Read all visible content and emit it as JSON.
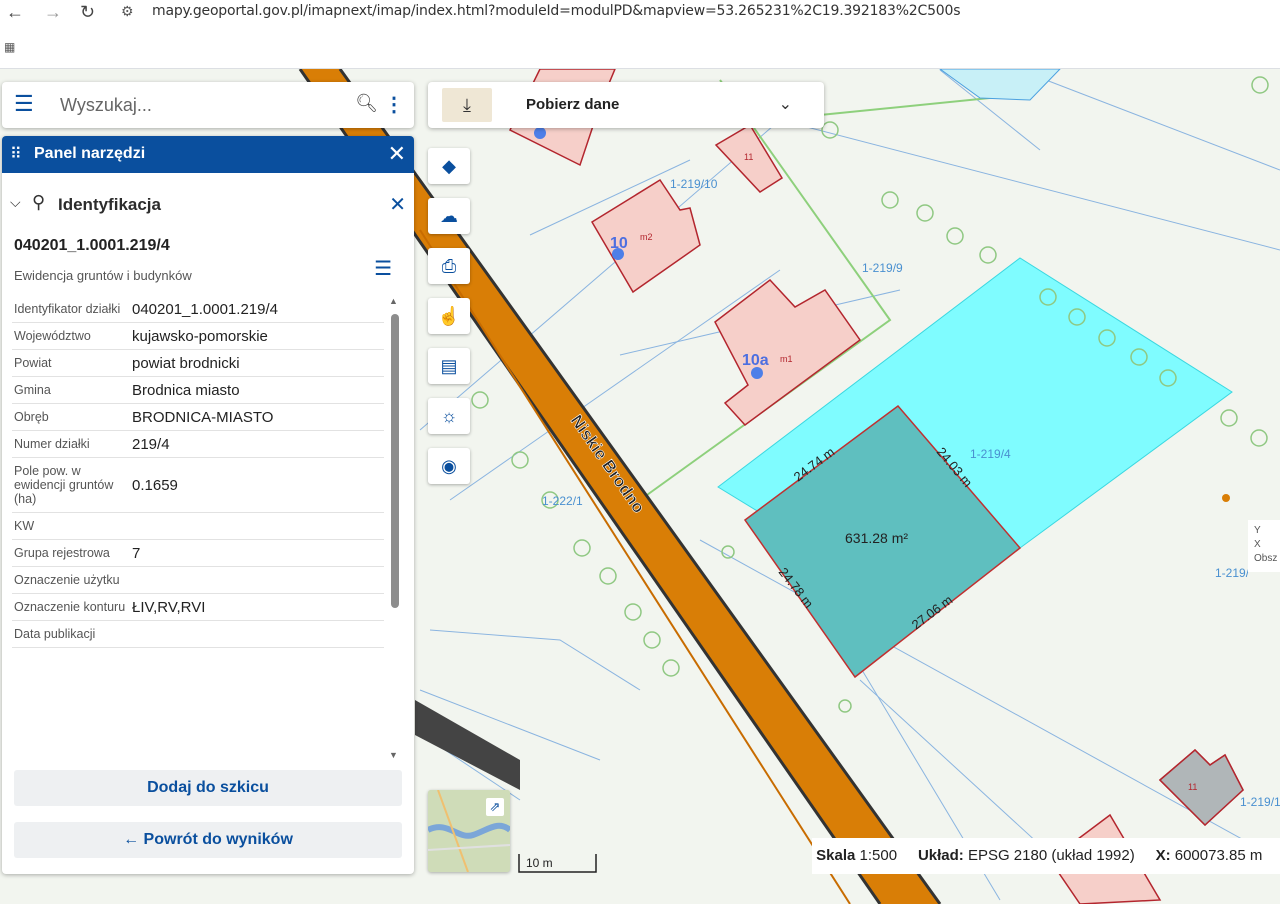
{
  "browser": {
    "back_icon": "arrow-left-icon",
    "forward_icon": "arrow-right-icon",
    "reload_icon": "reload-icon",
    "url": "mapy.geoportal.gov.pl/imapnext/imap/index.html?moduleId=modulPD&mapview=53.265231%2C19.392183%2C500s"
  },
  "search": {
    "placeholder": "Wyszukaj..."
  },
  "panel": {
    "title": "Panel narzędzi",
    "section_title": "Identyfikacja",
    "parcel_id": "040201_1.0001.219/4",
    "parcel_subtitle": "Ewidencja gruntów i budynków",
    "attributes": [
      {
        "key": "Identyfikator działki",
        "value": "040201_1.0001.219/4"
      },
      {
        "key": "Województwo",
        "value": "kujawsko-pomorskie"
      },
      {
        "key": "Powiat",
        "value": "powiat brodnicki"
      },
      {
        "key": "Gmina",
        "value": "Brodnica miasto"
      },
      {
        "key": "Obręb",
        "value": "BRODNICA-MIASTO"
      },
      {
        "key": "Numer działki",
        "value": "219/4"
      },
      {
        "key": "Pole pow. w ewidencji gruntów (ha)",
        "value": "0.1659"
      },
      {
        "key": "KW",
        "value": ""
      },
      {
        "key": "Grupa rejestrowa",
        "value": "7"
      },
      {
        "key": "Oznaczenie użytku",
        "value": ""
      },
      {
        "key": "Oznaczenie konturu",
        "value": "ŁIV,RV,RVI"
      },
      {
        "key": "Data publikacji",
        "value": ""
      }
    ],
    "add_sketch_label": "Dodaj do szkicu",
    "back_label": "Powrót do wyników",
    "back_arrow": "←"
  },
  "download": {
    "label": "Pobierz dane"
  },
  "tools": [
    "layers-icon",
    "cloud-add-icon",
    "print-icon",
    "touch-identify-icon",
    "clipboard-icon",
    "sunrise-icon",
    "camera-icon"
  ],
  "map": {
    "street_name": "Niskie Brodno",
    "parcel_labels": [
      "1-219/10",
      "1-219/9",
      "1-219/4",
      "1-222/1",
      "1-219/",
      "1-219/1"
    ],
    "building_labels": [
      "10",
      "10a",
      "m2",
      "m1",
      "11",
      "11"
    ],
    "measurements": [
      "24.74 m",
      "24.03 m",
      "24.78 m",
      "27.06 m"
    ],
    "area": "631.28 m²"
  },
  "scale_bar": {
    "label": "10 m"
  },
  "status": {
    "scale_label": "Skala",
    "scale_value": "1:500",
    "crs_label": "Układ:",
    "crs_value": "EPSG 2180 (układ 1992)",
    "x_label": "X:",
    "x_value": "600073.85 m"
  },
  "coord_box": {
    "y": "Y",
    "x": "X",
    "area": "Obsz"
  },
  "colors": {
    "brand": "#0a4f9e",
    "selected_parcel": "#7ffcff",
    "measured_area": "#5fbfbf",
    "road": "#d97e06"
  }
}
